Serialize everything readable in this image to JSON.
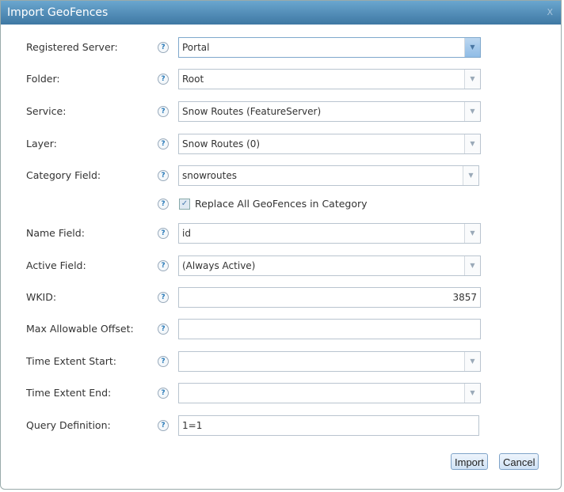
{
  "dialog": {
    "title": "Import GeoFences",
    "close_label": "X"
  },
  "fields": [
    {
      "label": "Registered Server:",
      "value": "Portal",
      "type": "select"
    },
    {
      "label": "Folder:",
      "value": "Root",
      "type": "select"
    },
    {
      "label": "Service:",
      "value": "Snow Routes (FeatureServer)",
      "type": "select"
    },
    {
      "label": "Layer:",
      "value": "Snow Routes (0)",
      "type": "select"
    },
    {
      "label": "Category Field:",
      "value": "snowroutes",
      "type": "select"
    },
    {
      "label": "Name Field:",
      "value": "id",
      "type": "select"
    },
    {
      "label": "Active Field:",
      "value": "(Always Active)",
      "type": "select"
    },
    {
      "label": "WKID:",
      "value": "3857",
      "type": "text"
    },
    {
      "label": "Max Allowable Offset:",
      "value": "",
      "type": "text"
    },
    {
      "label": "Time Extent Start:",
      "value": "",
      "type": "select"
    },
    {
      "label": "Time Extent End:",
      "value": "",
      "type": "select"
    },
    {
      "label": "Query Definition:",
      "value": "1=1",
      "type": "text"
    }
  ],
  "replace_checkbox": {
    "label": "Replace All GeoFences in Category",
    "checked": true
  },
  "help_glyph": "?",
  "buttons": {
    "import": "Import",
    "cancel": "Cancel"
  }
}
